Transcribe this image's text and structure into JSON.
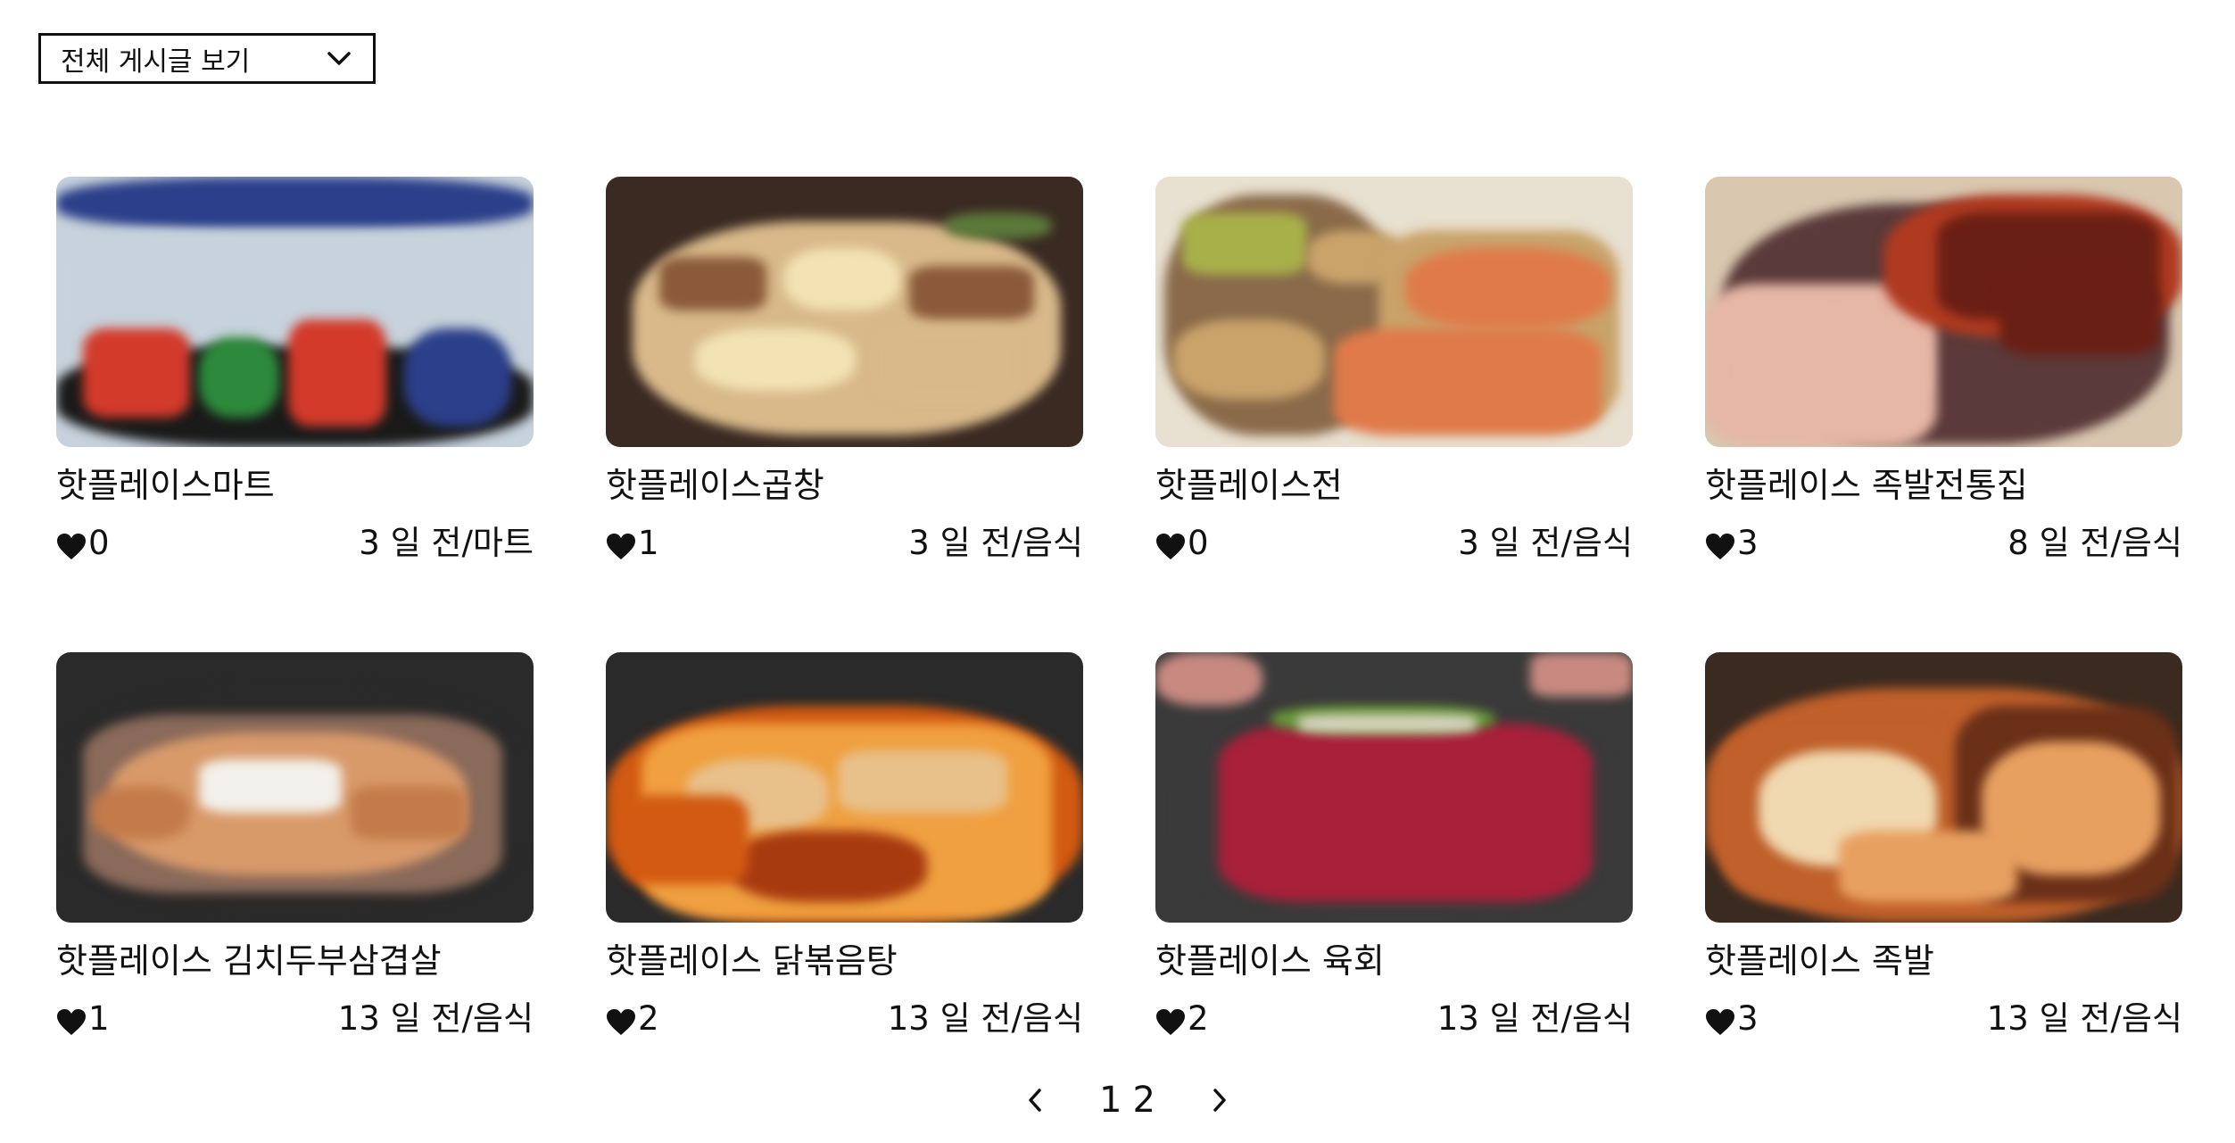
{
  "filter": {
    "label": "전체 게시글 보기",
    "icon": "chevron-down-icon"
  },
  "cards": [
    {
      "title": "핫플레이스마트",
      "likes": "0",
      "meta": "3 일 전/마트",
      "image": {
        "subject": "supermarket-drinks-aisle",
        "colors": [
          "#c7d2dc",
          "#2b3f8a",
          "#d33a2a",
          "#2d8a3c",
          "#1a1a1a"
        ]
      }
    },
    {
      "title": "핫플레이스곱창",
      "likes": "1",
      "meta": "3 일 전/음식",
      "image": {
        "subject": "grilled-gopchang-pan",
        "colors": [
          "#3a2a22",
          "#d9b98a",
          "#8a5a3a",
          "#f2e2b4",
          "#5c7a3a"
        ]
      }
    },
    {
      "title": "핫플레이스전",
      "likes": "0",
      "meta": "3 일 전/음식",
      "image": {
        "subject": "korean-pancakes-platter",
        "colors": [
          "#8a6a4a",
          "#c9a36a",
          "#e07a4a",
          "#a8b04a",
          "#e8e0d0"
        ]
      }
    },
    {
      "title": "핫플레이스 족발전통집",
      "likes": "3",
      "meta": "8 일 전/음식",
      "image": {
        "subject": "jokbal-and-spicy-chicken",
        "colors": [
          "#6a1f14",
          "#b03a20",
          "#e6b6a6",
          "#5a3a3a",
          "#d9c7b0"
        ]
      }
    },
    {
      "title": "핫플레이스 김치두부삼겹살",
      "likes": "1",
      "meta": "13 일 전/음식",
      "image": {
        "subject": "pork-belly-grill",
        "colors": [
          "#2a2a2a",
          "#d99a6a",
          "#f2f0ea",
          "#8a6a5a",
          "#c47a4a"
        ]
      }
    },
    {
      "title": "핫플레이스 닭볶음탕",
      "likes": "2",
      "meta": "13 일 전/음식",
      "image": {
        "subject": "spicy-braised-chicken",
        "colors": [
          "#d25a12",
          "#f0a040",
          "#2a2a2a",
          "#e8c08a",
          "#a83a10"
        ]
      }
    },
    {
      "title": "핫플레이스 육회",
      "likes": "2",
      "meta": "13 일 전/음식",
      "image": {
        "subject": "yukhoe-beef-tartare",
        "colors": [
          "#3a3a3a",
          "#a8203a",
          "#d8d4c0",
          "#6a9a3a",
          "#c88a80"
        ]
      }
    },
    {
      "title": "핫플레이스 족발",
      "likes": "3",
      "meta": "13 일 전/음식",
      "image": {
        "subject": "jokbal-platter",
        "colors": [
          "#6a3018",
          "#c0602a",
          "#f0d8b0",
          "#3a2a20",
          "#e8a060"
        ]
      }
    }
  ],
  "pagination": {
    "prev_icon": "chevron-left-icon",
    "next_icon": "chevron-right-icon",
    "pages": [
      "1",
      "2"
    ]
  }
}
